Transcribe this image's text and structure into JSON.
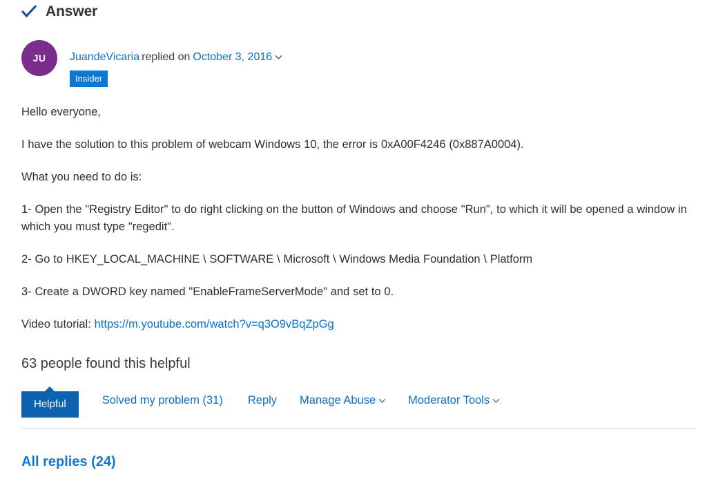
{
  "answer": {
    "heading": "Answer",
    "check_icon": "check-icon",
    "accent_blue": "#0a70c4",
    "check_color": "#12508f"
  },
  "author": {
    "initials": "JU",
    "avatar_color": "#7b2d8b",
    "name": "JuandeVicaria",
    "replied_text": "replied on",
    "date": "October 3, 2016",
    "chevron_icon": "chevron-down-icon",
    "badge": "Insider",
    "badge_color": "#0a78d4"
  },
  "body": {
    "paragraphs": [
      "Hello everyone,",
      "I have the solution to this problem of webcam Windows 10, the error is 0xA00F4246 (0x887A0004).",
      "What you need to do is:",
      "1- Open the \"Registry Editor\" to do right clicking on the button of Windows and choose \"Run\", to which it will be opened a window in which you must type \"regedit\".",
      "2- Go to HKEY_LOCAL_MACHINE \\ SOFTWARE \\ Microsoft \\ Windows Media Foundation \\ Platform",
      "3- Create a DWORD key named \"EnableFrameServerMode\" and set to 0."
    ],
    "video_label": "Video tutorial: ",
    "video_url": "https://m.youtube.com/watch?v=q3O9vBqZpGg"
  },
  "feedback": {
    "helpful_count_text": "63 people found this helpful",
    "helpful_button": "Helpful",
    "helpful_button_color": "#0a62b0",
    "solved_link": "Solved my problem (31)",
    "reply_link": "Reply",
    "manage_abuse_link": "Manage Abuse",
    "moderator_tools_link": "Moderator Tools",
    "dropdown_icon": "chevron-down-icon"
  },
  "footer": {
    "all_replies": "All replies (24)"
  }
}
